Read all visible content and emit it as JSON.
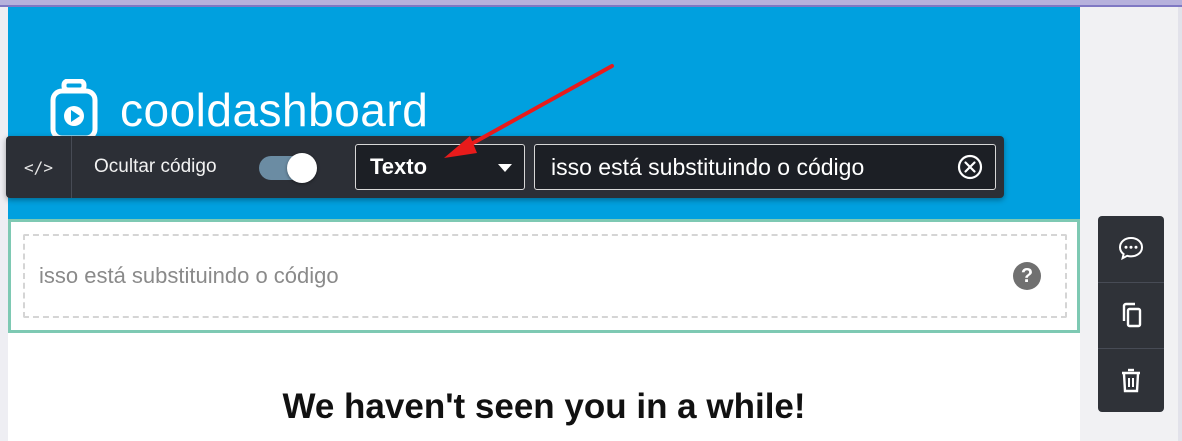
{
  "brand": {
    "name": "cooldashboard",
    "hero_color": "#00a0df"
  },
  "toolbar": {
    "code_toggle_label": "</>",
    "hide_code_label": "Ocultar código",
    "hide_code_enabled": true,
    "type_selected": "Texto",
    "code_value": "isso está substituindo o código"
  },
  "block": {
    "text": "isso está substituindo o código",
    "help_label": "?",
    "border_color": "#7ec9b3"
  },
  "content": {
    "headline": "We haven't seen you in a while!"
  },
  "actions": {
    "items": [
      {
        "icon": "comment-icon"
      },
      {
        "icon": "duplicate-icon"
      },
      {
        "icon": "trash-icon"
      }
    ]
  },
  "annotation": {
    "arrow_color": "#e81b1b"
  }
}
